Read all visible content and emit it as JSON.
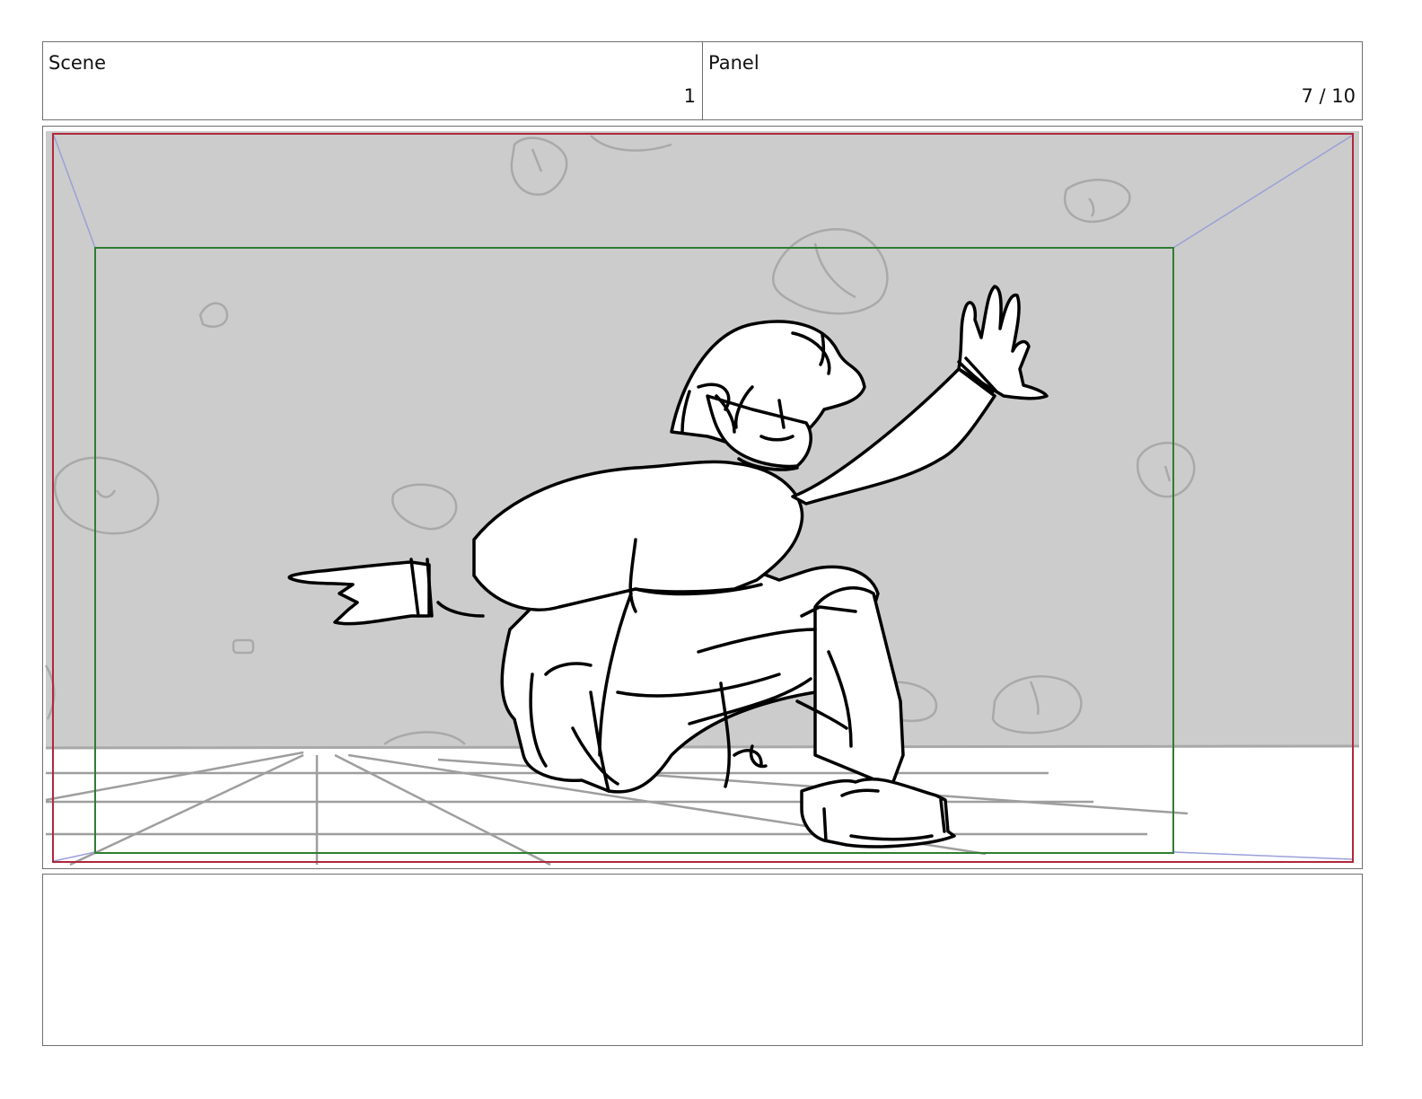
{
  "header": {
    "scene_label": "Scene",
    "scene_value": "1",
    "panel_label": "Panel",
    "panel_value": "7 / 10"
  },
  "frame": {
    "background_color": "#cccccc",
    "floor_color": "#ffffff",
    "safe_area_color": "#2e7d32",
    "camera_frame_color": "#b0283a",
    "guide_color": "#9aa0d8"
  },
  "notes": {
    "text": ""
  }
}
